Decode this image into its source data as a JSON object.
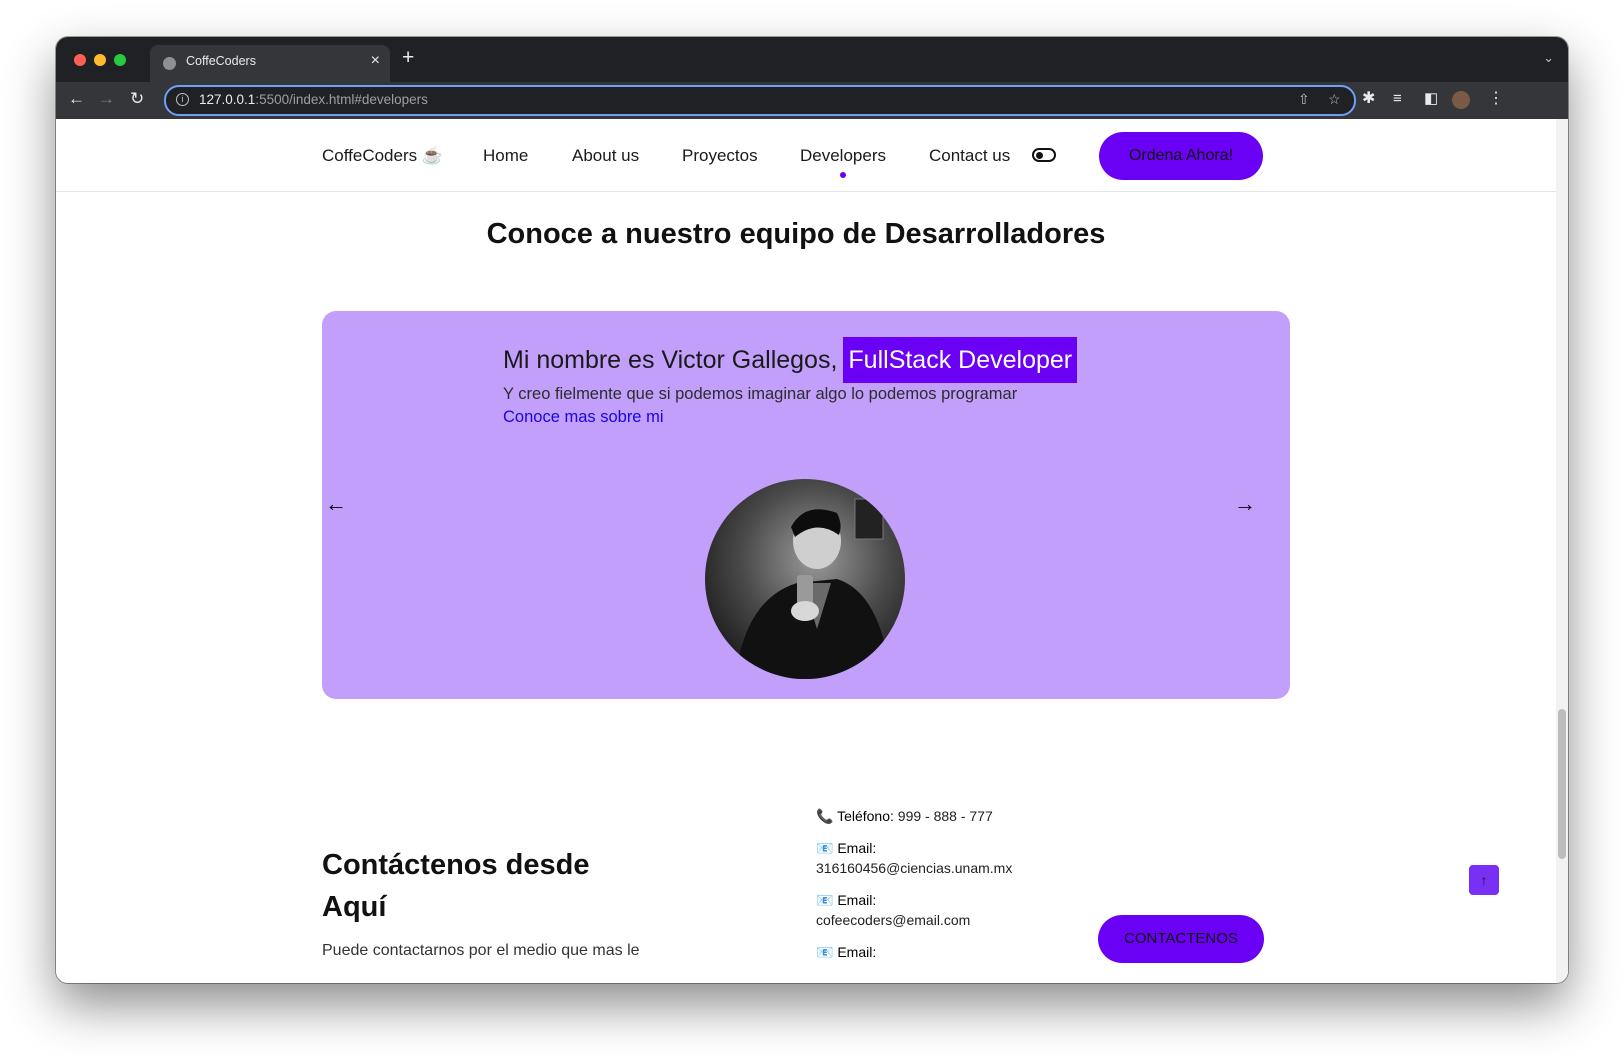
{
  "browser": {
    "tab_title": "CoffeCoders",
    "close_glyph": "×",
    "new_tab_glyph": "+",
    "url_host": "127.0.0.1",
    "url_path": ":5500/index.html#developers"
  },
  "nav": {
    "brand": "CoffeCoders ☕",
    "items": [
      "Home",
      "About us",
      "Proyectos",
      "Developers",
      "Contact us"
    ],
    "active": "Developers",
    "cta": "Ordena Ahora!"
  },
  "developers": {
    "title": "Conoce a nuestro equipo de Desarrolladores",
    "name_text": "Mi nombre es Victor Gallegos,",
    "role": "FullStack Developer",
    "quote": "Y creo fielmente que si podemos imaginar algo lo podemos programar",
    "link": "Conoce mas sobre mi",
    "prev_glyph": "←",
    "next_glyph": "→"
  },
  "contact": {
    "title": "Contáctenos desde Aquí",
    "description": "Puede contactarnos por el medio que mas le",
    "phone_icon": "📞",
    "phone_label": "Teléfono:",
    "phone_value": "999 - 888 - 777",
    "email_icon": "📧",
    "email_label": "Email:",
    "email_1": "316160456@ciencias.unam.mx",
    "email_2": "cofeecoders@email.com",
    "button": "CONTACTENOS"
  },
  "scroll_top_glyph": "↑",
  "colors": {
    "accent": "#6a00f4",
    "card_bg": "#c29ffb",
    "link": "#1606e6"
  }
}
